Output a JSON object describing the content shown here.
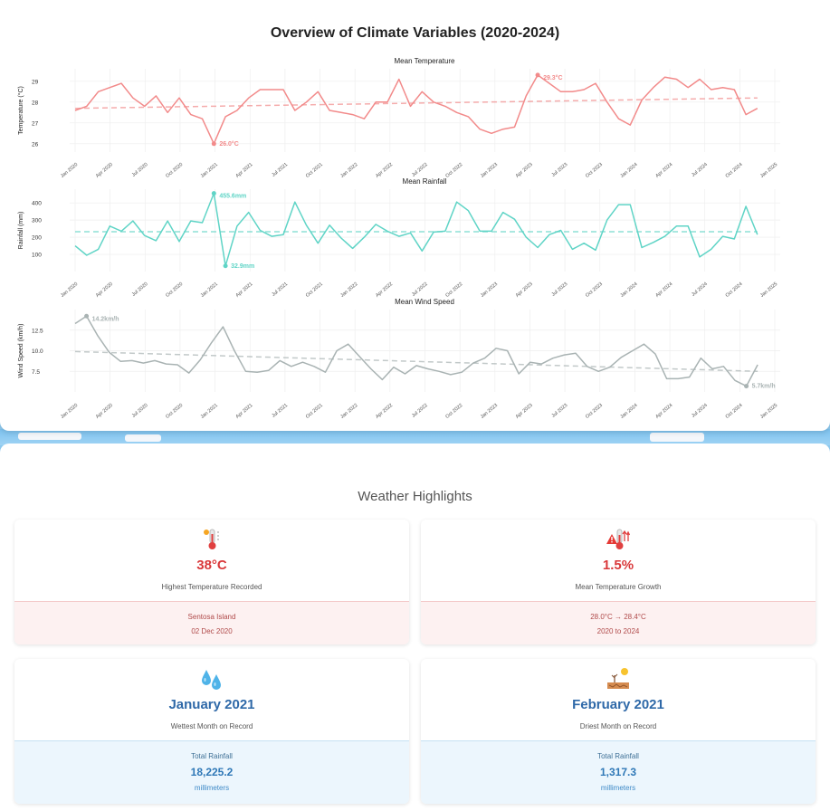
{
  "page": {
    "title": "Overview of Climate Variables (2020-2024)"
  },
  "colors": {
    "temperature": "#f28a8a",
    "rainfall": "#5fd4c6",
    "wind": "#a9b3b3",
    "text": "#222222"
  },
  "chart_data": [
    {
      "type": "line",
      "title": "Mean Temperature",
      "ylabel": "Temperature (°C)",
      "ylim": [
        25.6,
        29.6
      ],
      "yticks": [
        "26",
        "27",
        "28",
        "29"
      ],
      "ytick_values": [
        26,
        27,
        28,
        29
      ],
      "x_tick_labels": [
        "Jan 2020",
        "Apr 2020",
        "Jul 2020",
        "Oct 2020",
        "Jan 2021",
        "Apr 2021",
        "Jul 2021",
        "Oct 2021",
        "Jan 2022",
        "Apr 2022",
        "Jul 2022",
        "Oct 2022",
        "Jan 2023",
        "Apr 2023",
        "Jul 2023",
        "Oct 2023",
        "Jan 2024",
        "Apr 2024",
        "Jul 2024",
        "Oct 2024",
        "Jan 2025"
      ],
      "values": [
        27.6,
        27.8,
        28.5,
        28.7,
        28.9,
        28.2,
        27.8,
        28.3,
        27.5,
        28.2,
        27.4,
        27.2,
        26.0,
        27.3,
        27.6,
        28.2,
        28.6,
        28.6,
        28.6,
        27.6,
        28.0,
        28.5,
        27.6,
        27.5,
        27.4,
        27.2,
        28.0,
        28.0,
        29.1,
        27.8,
        28.5,
        28.0,
        27.8,
        27.5,
        27.3,
        26.7,
        26.5,
        26.7,
        26.8,
        28.3,
        29.3,
        28.9,
        28.5,
        28.5,
        28.6,
        28.9,
        28.0,
        27.2,
        26.9,
        28.1,
        28.7,
        29.2,
        29.1,
        28.7,
        29.1,
        28.6,
        28.7,
        28.6,
        27.4,
        27.7
      ],
      "trend": [
        27.7,
        28.2
      ],
      "annotations": {
        "max_label": "29.3°C",
        "min_label": "26.0°C"
      },
      "max_index": 40,
      "min_index": 12
    },
    {
      "type": "line",
      "title": "Mean Rainfall",
      "ylabel": "Rainfall (mm)",
      "ylim": [
        0,
        480
      ],
      "yticks": [
        "100",
        "200",
        "300",
        "400"
      ],
      "ytick_values": [
        100,
        200,
        300,
        400
      ],
      "x_tick_labels": [
        "Jan 2020",
        "Apr 2020",
        "Jul 2020",
        "Oct 2020",
        "Jan 2021",
        "Apr 2021",
        "Jul 2021",
        "Oct 2021",
        "Jan 2022",
        "Apr 2022",
        "Jul 2022",
        "Oct 2022",
        "Jan 2023",
        "Apr 2023",
        "Jul 2023",
        "Oct 2023",
        "Jan 2024",
        "Apr 2024",
        "Jul 2024",
        "Oct 2024",
        "Jan 2025"
      ],
      "values": [
        150,
        95,
        130,
        265,
        235,
        295,
        210,
        180,
        295,
        175,
        295,
        285,
        455.6,
        32.9,
        265,
        345,
        240,
        205,
        215,
        405,
        270,
        165,
        270,
        195,
        135,
        200,
        275,
        235,
        205,
        225,
        120,
        230,
        235,
        405,
        355,
        235,
        235,
        345,
        305,
        200,
        140,
        215,
        240,
        130,
        165,
        125,
        300,
        390,
        390,
        140,
        170,
        205,
        265,
        265,
        85,
        130,
        205,
        190,
        380,
        215
      ],
      "trend": [
        232,
        232
      ],
      "annotations": {
        "max_label": "455.6mm",
        "min_label": "32.9mm"
      },
      "max_index": 12,
      "min_index": 13
    },
    {
      "type": "line",
      "title": "Mean Wind Speed",
      "ylabel": "Wind Speed (km/h)",
      "ylim": [
        5,
        15
      ],
      "yticks": [
        "7.5",
        "10.0",
        "12.5"
      ],
      "ytick_values": [
        7.5,
        10.0,
        12.5
      ],
      "x_tick_labels": [
        "Jan 2020",
        "Apr 2020",
        "Jul 2020",
        "Oct 2020",
        "Jan 2021",
        "Apr 2021",
        "Jul 2021",
        "Oct 2021",
        "Jan 2022",
        "Apr 2022",
        "Jul 2022",
        "Oct 2022",
        "Jan 2023",
        "Apr 2023",
        "Jul 2023",
        "Oct 2023",
        "Jan 2024",
        "Apr 2024",
        "Jul 2024",
        "Oct 2024",
        "Jan 2025"
      ],
      "values": [
        13.3,
        14.2,
        11.8,
        9.8,
        8.7,
        8.8,
        8.5,
        8.8,
        8.4,
        8.3,
        7.3,
        8.9,
        11.0,
        12.9,
        10.0,
        7.5,
        7.4,
        7.6,
        8.8,
        8.1,
        8.6,
        8.1,
        7.4,
        10.0,
        10.8,
        9.3,
        7.8,
        6.5,
        8.0,
        7.2,
        8.2,
        7.8,
        7.5,
        7.1,
        7.4,
        8.5,
        9.1,
        10.3,
        10.0,
        7.2,
        8.6,
        8.4,
        9.1,
        9.5,
        9.7,
        8.1,
        7.5,
        8.0,
        9.2,
        10.0,
        10.8,
        9.6,
        6.6,
        6.6,
        6.8,
        9.1,
        7.8,
        8.1,
        6.4,
        5.7,
        8.3
      ],
      "trend": [
        9.9,
        7.5
      ],
      "annotations": {
        "max_label": "14.2km/h",
        "min_label": "5.7km/h"
      },
      "max_index": 1,
      "min_index": 59
    }
  ],
  "highlights": {
    "title": "Weather Highlights",
    "cards": [
      {
        "icon": "thermometer-hot-icon",
        "value": "38°C",
        "label": "Highest Temperature Recorded",
        "detail1": "Sentosa Island",
        "detail2": "02 Dec 2020"
      },
      {
        "icon": "temperature-growth-icon",
        "value": "1.5%",
        "label": "Mean Temperature Growth",
        "detail1": "28.0°C → 28.4°C",
        "detail2": "2020 to 2024"
      },
      {
        "icon": "droplets-icon",
        "value": "January 2021",
        "label": "Wettest Month on Record",
        "detail1": "Total Rainfall",
        "detail2": "18,225.2",
        "detail3": "millimeters"
      },
      {
        "icon": "dry-desert-icon",
        "value": "February 2021",
        "label": "Driest Month on Record",
        "detail1": "Total Rainfall",
        "detail2": "1,317.3",
        "detail3": "millimeters"
      }
    ]
  }
}
